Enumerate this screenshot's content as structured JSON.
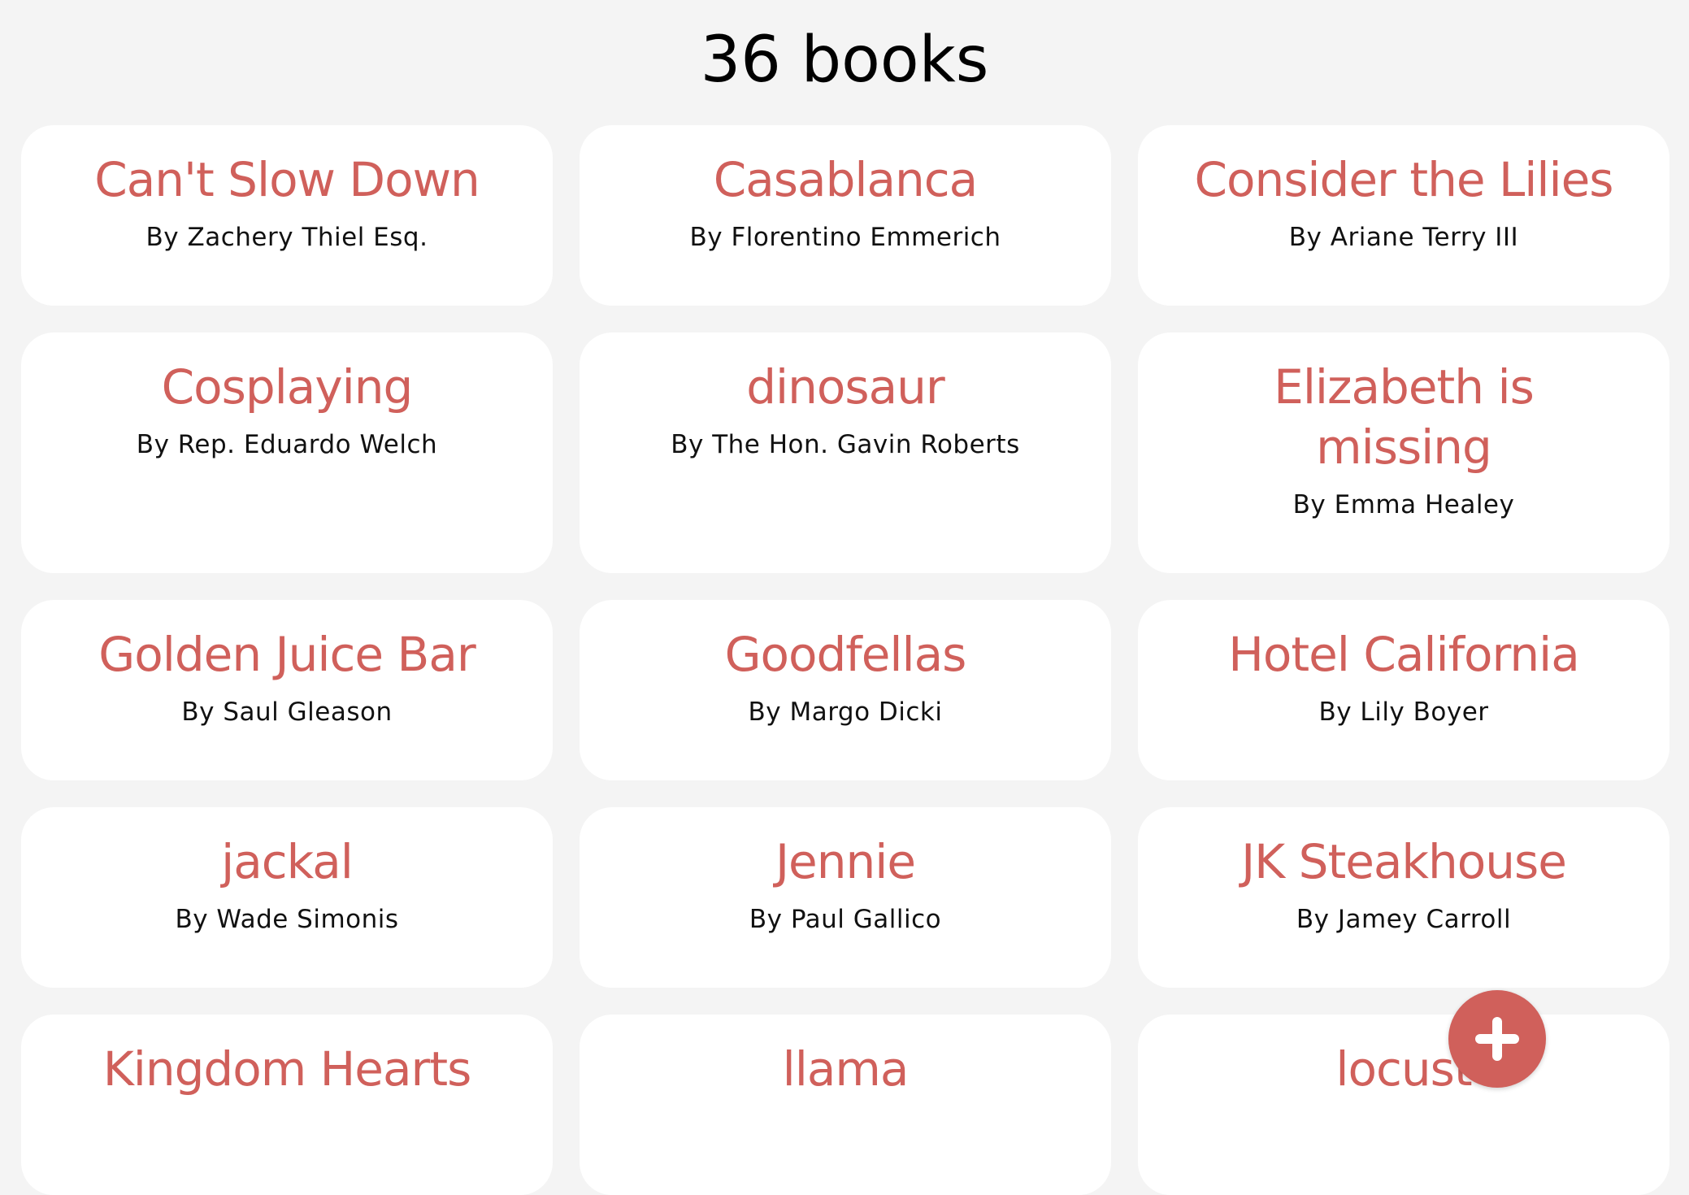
{
  "header": {
    "title": "36 books"
  },
  "books": [
    {
      "title": "Can't Slow Down",
      "author": "By Zachery Thiel Esq."
    },
    {
      "title": "Casablanca",
      "author": "By Florentino Emmerich"
    },
    {
      "title": "Consider the Lilies",
      "author": "By Ariane Terry III"
    },
    {
      "title": "Cosplaying",
      "author": "By Rep. Eduardo Welch"
    },
    {
      "title": "dinosaur",
      "author": "By The Hon. Gavin Roberts"
    },
    {
      "title": "Elizabeth is missing",
      "author": "By Emma Healey"
    },
    {
      "title": "Golden Juice Bar",
      "author": "By Saul Gleason"
    },
    {
      "title": "Goodfellas",
      "author": "By Margo Dicki"
    },
    {
      "title": "Hotel California",
      "author": "By Lily Boyer"
    },
    {
      "title": "jackal",
      "author": "By Wade Simonis"
    },
    {
      "title": "Jennie",
      "author": "By Paul Gallico"
    },
    {
      "title": "JK Steakhouse",
      "author": "By Jamey Carroll"
    },
    {
      "title": "Kingdom Hearts",
      "author": ""
    },
    {
      "title": "llama",
      "author": ""
    },
    {
      "title": "locust",
      "author": ""
    }
  ],
  "fab": {
    "icon": "plus-icon"
  },
  "colors": {
    "background": "#f4f4f4",
    "card": "#ffffff",
    "accent": "#d0605b",
    "text": "#111111"
  }
}
